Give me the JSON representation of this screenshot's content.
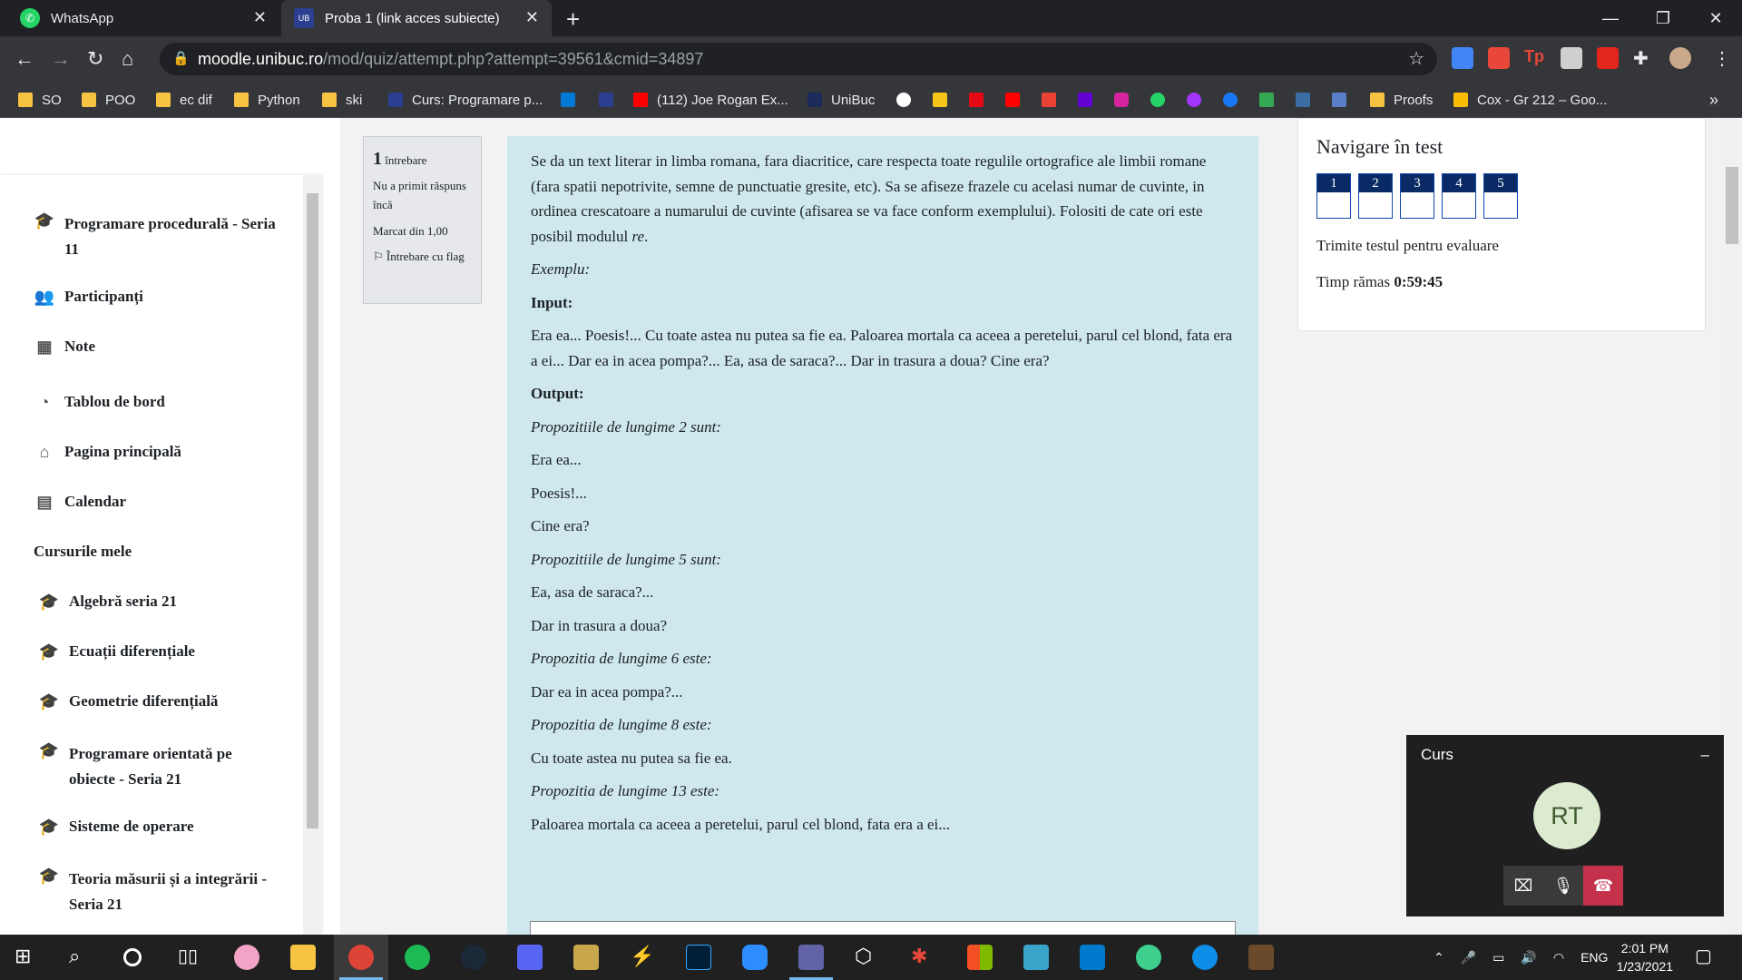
{
  "browser": {
    "tabs": [
      {
        "label": "WhatsApp",
        "icon": "whatsapp-icon",
        "active": false
      },
      {
        "label": "Proba 1 (link acces subiecte)",
        "icon": "moodle-icon",
        "active": true
      }
    ],
    "url_host": "moodle.unibuc.ro",
    "url_path": "/mod/quiz/attempt.php?attempt=39561&cmid=34897",
    "bookmarks": [
      "SO",
      "POO",
      "ec dif",
      "Python",
      "ski",
      "Curs: Programare p...",
      "(112) Joe Rogan Ex...",
      "UniBuc",
      "Proofs",
      "Cox - Gr 212 – Goo..."
    ],
    "bookmark_more": "»"
  },
  "sidebar": {
    "items": [
      {
        "label": "Programare procedurală - Seria 11",
        "icon": "graduation-cap-icon"
      },
      {
        "label": "Participanți",
        "icon": "users-icon"
      },
      {
        "label": "Note",
        "icon": "table-icon"
      },
      {
        "label": "Tablou de bord",
        "icon": "dashboard-icon"
      },
      {
        "label": "Pagina principală",
        "icon": "home-icon"
      },
      {
        "label": "Calendar",
        "icon": "calendar-icon"
      }
    ],
    "section_heading": "Cursurile mele",
    "courses": [
      "Algebră seria 21",
      "Ecuații diferențiale",
      "Geometrie diferențială",
      "Programare orientată pe obiecte - Seria 21",
      "Sisteme de operare",
      "Teoria măsurii și a integrării - Seria 21"
    ]
  },
  "question_info": {
    "number": "1",
    "number_label": "întrebare",
    "status": "Nu a primit răspuns încă",
    "marked": "Marcat din 1,00",
    "flag": "Întrebare cu flag"
  },
  "question": {
    "intro_1": "Se da un text literar in limba romana, fara diacritice, care respecta toate regulile ortografice ale limbii romane (fara spatii nepotrivite, semne de punctuatie gresite, etc). Sa se afiseze frazele cu acelasi numar de cuvinte, in ordinea crescatoare a numarului de cuvinte (afisarea se va face conform exemplului). Folositi de cate ori este posibil modulul ",
    "intro_module": "re",
    "intro_2": ".",
    "example_label": "Exemplu:",
    "input_label": "Input:",
    "input_text": "Era ea... Poesis!... Cu toate astea nu putea sa fie ea. Paloarea mortala ca aceea a peretelui, parul cel blond, fata era a ei... Dar ea in acea pompa?... Ea, asa de saraca?... Dar in trasura a doua? Cine era?",
    "output_label": "Output:",
    "output_lines": [
      {
        "text": "Propozitiile de lungime 2 sunt:",
        "italic": true
      },
      {
        "text": "Era ea...",
        "italic": false
      },
      {
        "text": "Poesis!...",
        "italic": false
      },
      {
        "text": "Cine era?",
        "italic": false
      },
      {
        "text": "Propozitiile de lungime 5 sunt:",
        "italic": true
      },
      {
        "text": "Ea, asa de saraca?...",
        "italic": false
      },
      {
        "text": "Dar in trasura a doua?",
        "italic": false
      },
      {
        "text": "Propozitia de lungime 6 este:",
        "italic": true
      },
      {
        "text": "Dar ea in acea pompa?...",
        "italic": false
      },
      {
        "text": "Propozitia de lungime 8 este:",
        "italic": true
      },
      {
        "text": "Cu toate astea nu putea sa fie ea.",
        "italic": false
      },
      {
        "text": "Propozitia de lungime 13 este:",
        "italic": true
      },
      {
        "text": "Paloarea mortala ca aceea a peretelui, parul cel blond, fata era a ei...",
        "italic": false
      }
    ]
  },
  "quiz_nav": {
    "title": "Navigare în test",
    "questions": [
      "1",
      "2",
      "3",
      "4",
      "5"
    ],
    "submit_link": "Trimite testul pentru evaluare",
    "timer_label": "Timp rămas ",
    "timer_value": "0:59:45"
  },
  "teams": {
    "title": "Curs",
    "minimize": "–",
    "avatar_initials": "RT"
  },
  "taskbar": {
    "language": "ENG",
    "time": "2:01 PM",
    "date": "1/23/2021"
  },
  "colors": {
    "question_bg": "#cee8ed",
    "nav_button_header": "#0a2a66",
    "chrome_dark": "#202124",
    "hangup_red": "#c4314b"
  }
}
